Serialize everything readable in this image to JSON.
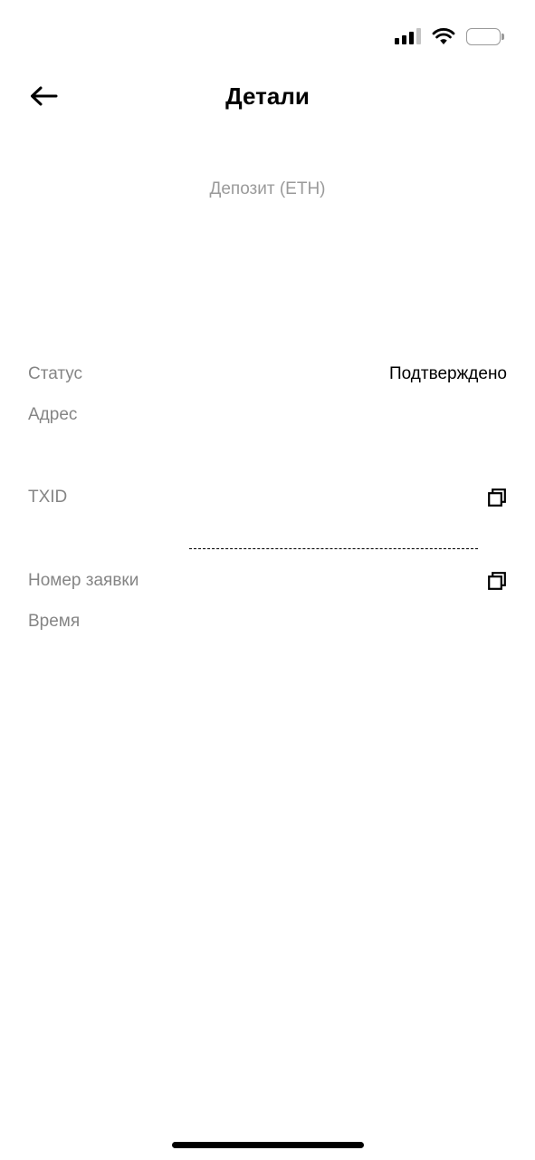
{
  "status_bar": {
    "icons": [
      "cellular-signal-icon",
      "wifi-icon",
      "battery-icon"
    ]
  },
  "header": {
    "title": "Детали",
    "back_icon": "arrow-left-icon"
  },
  "subtitle": "Депозит (ETH)",
  "details": {
    "status_label": "Статус",
    "status_value": "Подтверждено",
    "address_label": "Адрес",
    "txid_label": "TXID",
    "order_label": "Номер заявки",
    "time_label": "Время",
    "copy_icon": "copy-icon"
  },
  "colors": {
    "background": "#ffffff",
    "label": "#858585",
    "subtitle": "#9a9a9a",
    "text": "#000000"
  }
}
